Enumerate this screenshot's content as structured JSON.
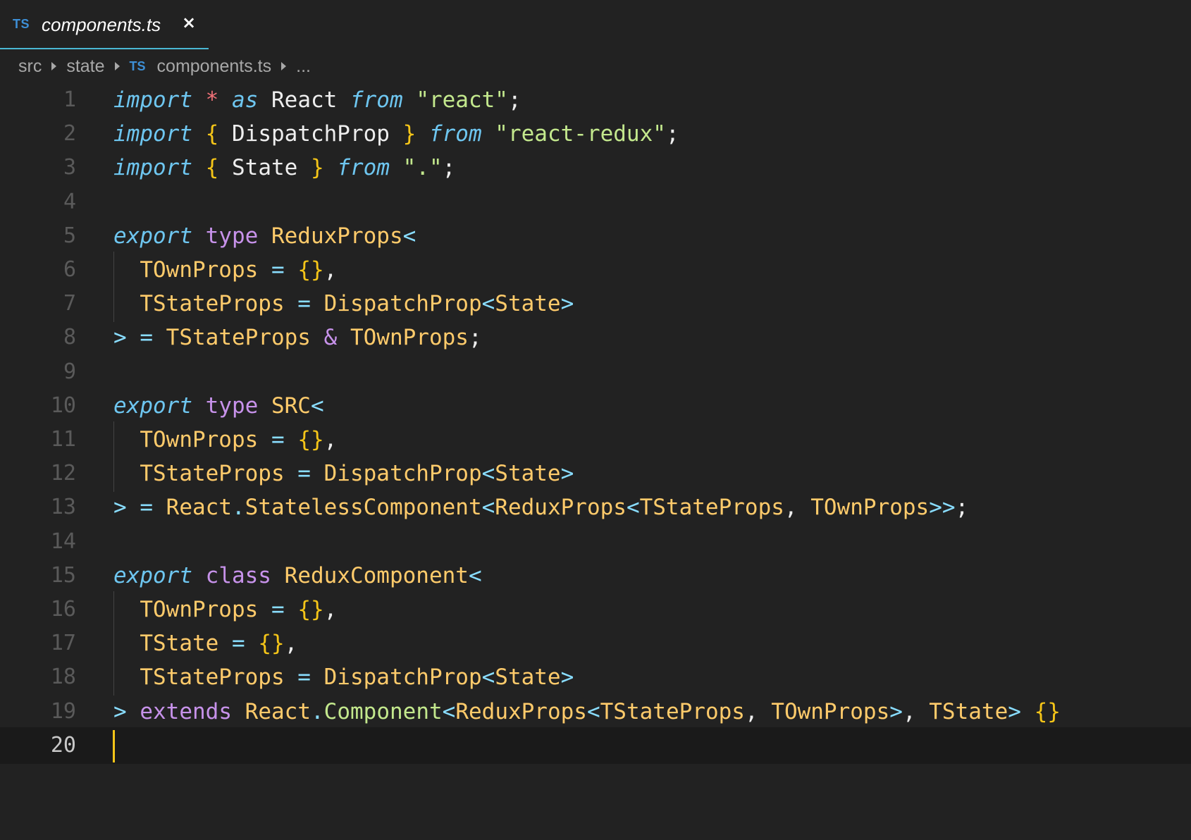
{
  "tab": {
    "icon_text": "TS",
    "label": "components.ts",
    "close_glyph": "×"
  },
  "breadcrumb": {
    "items": [
      "src",
      "state",
      "components.ts",
      "..."
    ],
    "file_icon_text": "TS"
  },
  "colors": {
    "keyword_italic": "#6ec6f0",
    "keyword_purple": "#c792ea",
    "type_name": "#ffcb6b",
    "string": "#c3e88d",
    "plain": "#eeeeee",
    "punct": "#89ddff",
    "brace": "#f5c518",
    "operator_star": "#f07178",
    "cursor": "#f5c518"
  },
  "editor": {
    "active_line": 20,
    "lines": [
      {
        "n": "1",
        "tokens": [
          {
            "t": "import",
            "c": "kwi"
          },
          {
            "t": " ",
            "c": "p"
          },
          {
            "t": "*",
            "c": "star"
          },
          {
            "t": " ",
            "c": "p"
          },
          {
            "t": "as",
            "c": "kwi"
          },
          {
            "t": " React ",
            "c": "p"
          },
          {
            "t": "from",
            "c": "kwi"
          },
          {
            "t": " ",
            "c": "p"
          },
          {
            "t": "\"react\"",
            "c": "str"
          },
          {
            "t": ";",
            "c": "p"
          }
        ]
      },
      {
        "n": "2",
        "tokens": [
          {
            "t": "import",
            "c": "kwi"
          },
          {
            "t": " ",
            "c": "p"
          },
          {
            "t": "{",
            "c": "br"
          },
          {
            "t": " DispatchProp ",
            "c": "p"
          },
          {
            "t": "}",
            "c": "br"
          },
          {
            "t": " ",
            "c": "p"
          },
          {
            "t": "from",
            "c": "kwi"
          },
          {
            "t": " ",
            "c": "p"
          },
          {
            "t": "\"react-redux\"",
            "c": "str"
          },
          {
            "t": ";",
            "c": "p"
          }
        ]
      },
      {
        "n": "3",
        "tokens": [
          {
            "t": "import",
            "c": "kwi"
          },
          {
            "t": " ",
            "c": "p"
          },
          {
            "t": "{",
            "c": "br"
          },
          {
            "t": " State ",
            "c": "p"
          },
          {
            "t": "}",
            "c": "br"
          },
          {
            "t": " ",
            "c": "p"
          },
          {
            "t": "from",
            "c": "kwi"
          },
          {
            "t": " ",
            "c": "p"
          },
          {
            "t": "\".\"",
            "c": "str"
          },
          {
            "t": ";",
            "c": "p"
          }
        ]
      },
      {
        "n": "4",
        "tokens": []
      },
      {
        "n": "5",
        "tokens": [
          {
            "t": "export",
            "c": "kwi"
          },
          {
            "t": " ",
            "c": "p"
          },
          {
            "t": "type",
            "c": "kwp"
          },
          {
            "t": " ",
            "c": "p"
          },
          {
            "t": "ReduxProps",
            "c": "ty"
          },
          {
            "t": "<",
            "c": "pu"
          }
        ]
      },
      {
        "n": "6",
        "guide": true,
        "tokens": [
          {
            "t": "  ",
            "c": "p"
          },
          {
            "t": "TOwnProps",
            "c": "ty"
          },
          {
            "t": " = ",
            "c": "pu"
          },
          {
            "t": "{}",
            "c": "br"
          },
          {
            "t": ",",
            "c": "p"
          }
        ]
      },
      {
        "n": "7",
        "guide": true,
        "tokens": [
          {
            "t": "  ",
            "c": "p"
          },
          {
            "t": "TStateProps",
            "c": "ty"
          },
          {
            "t": " = ",
            "c": "pu"
          },
          {
            "t": "DispatchProp",
            "c": "ty"
          },
          {
            "t": "<",
            "c": "pu"
          },
          {
            "t": "State",
            "c": "ty"
          },
          {
            "t": ">",
            "c": "pu"
          }
        ]
      },
      {
        "n": "8",
        "tokens": [
          {
            "t": ">",
            "c": "pu"
          },
          {
            "t": " = ",
            "c": "pu"
          },
          {
            "t": "TStateProps",
            "c": "ty"
          },
          {
            "t": " ",
            "c": "p"
          },
          {
            "t": "&",
            "c": "kwp"
          },
          {
            "t": " ",
            "c": "p"
          },
          {
            "t": "TOwnProps",
            "c": "ty"
          },
          {
            "t": ";",
            "c": "p"
          }
        ]
      },
      {
        "n": "9",
        "tokens": []
      },
      {
        "n": "10",
        "tokens": [
          {
            "t": "export",
            "c": "kwi"
          },
          {
            "t": " ",
            "c": "p"
          },
          {
            "t": "type",
            "c": "kwp"
          },
          {
            "t": " ",
            "c": "p"
          },
          {
            "t": "SRC",
            "c": "ty"
          },
          {
            "t": "<",
            "c": "pu"
          }
        ]
      },
      {
        "n": "11",
        "guide": true,
        "tokens": [
          {
            "t": "  ",
            "c": "p"
          },
          {
            "t": "TOwnProps",
            "c": "ty"
          },
          {
            "t": " = ",
            "c": "pu"
          },
          {
            "t": "{}",
            "c": "br"
          },
          {
            "t": ",",
            "c": "p"
          }
        ]
      },
      {
        "n": "12",
        "guide": true,
        "tokens": [
          {
            "t": "  ",
            "c": "p"
          },
          {
            "t": "TStateProps",
            "c": "ty"
          },
          {
            "t": " = ",
            "c": "pu"
          },
          {
            "t": "DispatchProp",
            "c": "ty"
          },
          {
            "t": "<",
            "c": "pu"
          },
          {
            "t": "State",
            "c": "ty"
          },
          {
            "t": ">",
            "c": "pu"
          }
        ]
      },
      {
        "n": "13",
        "tokens": [
          {
            "t": ">",
            "c": "pu"
          },
          {
            "t": " = ",
            "c": "pu"
          },
          {
            "t": "React",
            "c": "ty"
          },
          {
            "t": ".",
            "c": "pu"
          },
          {
            "t": "StatelessComponent",
            "c": "ty"
          },
          {
            "t": "<",
            "c": "pu"
          },
          {
            "t": "ReduxProps",
            "c": "ty"
          },
          {
            "t": "<",
            "c": "pu"
          },
          {
            "t": "TStateProps",
            "c": "ty"
          },
          {
            "t": ", ",
            "c": "p"
          },
          {
            "t": "TOwnProps",
            "c": "ty"
          },
          {
            "t": ">>",
            "c": "pu"
          },
          {
            "t": ";",
            "c": "p"
          }
        ]
      },
      {
        "n": "14",
        "tokens": []
      },
      {
        "n": "15",
        "tokens": [
          {
            "t": "export",
            "c": "kwi"
          },
          {
            "t": " ",
            "c": "p"
          },
          {
            "t": "class",
            "c": "kwp"
          },
          {
            "t": " ",
            "c": "p"
          },
          {
            "t": "ReduxComponent",
            "c": "ty"
          },
          {
            "t": "<",
            "c": "pu"
          }
        ]
      },
      {
        "n": "16",
        "guide": true,
        "tokens": [
          {
            "t": "  ",
            "c": "p"
          },
          {
            "t": "TOwnProps",
            "c": "ty"
          },
          {
            "t": " = ",
            "c": "pu"
          },
          {
            "t": "{}",
            "c": "br"
          },
          {
            "t": ",",
            "c": "p"
          }
        ]
      },
      {
        "n": "17",
        "guide": true,
        "tokens": [
          {
            "t": "  ",
            "c": "p"
          },
          {
            "t": "TState",
            "c": "ty"
          },
          {
            "t": " = ",
            "c": "pu"
          },
          {
            "t": "{}",
            "c": "br"
          },
          {
            "t": ",",
            "c": "p"
          }
        ]
      },
      {
        "n": "18",
        "guide": true,
        "tokens": [
          {
            "t": "  ",
            "c": "p"
          },
          {
            "t": "TStateProps",
            "c": "ty"
          },
          {
            "t": " = ",
            "c": "pu"
          },
          {
            "t": "DispatchProp",
            "c": "ty"
          },
          {
            "t": "<",
            "c": "pu"
          },
          {
            "t": "State",
            "c": "ty"
          },
          {
            "t": ">",
            "c": "pu"
          }
        ]
      },
      {
        "n": "19",
        "tokens": [
          {
            "t": ">",
            "c": "pu"
          },
          {
            "t": " ",
            "c": "p"
          },
          {
            "t": "extends",
            "c": "kwp"
          },
          {
            "t": " ",
            "c": "p"
          },
          {
            "t": "React",
            "c": "ty"
          },
          {
            "t": ".",
            "c": "pu"
          },
          {
            "t": "Component",
            "c": "fn"
          },
          {
            "t": "<",
            "c": "pu"
          },
          {
            "t": "ReduxProps",
            "c": "ty"
          },
          {
            "t": "<",
            "c": "pu"
          },
          {
            "t": "TStateProps",
            "c": "ty"
          },
          {
            "t": ", ",
            "c": "p"
          },
          {
            "t": "TOwnProps",
            "c": "ty"
          },
          {
            "t": ">",
            "c": "pu"
          },
          {
            "t": ", ",
            "c": "p"
          },
          {
            "t": "TState",
            "c": "ty"
          },
          {
            "t": ">",
            "c": "pu"
          },
          {
            "t": " ",
            "c": "p"
          },
          {
            "t": "{}",
            "c": "br"
          }
        ]
      },
      {
        "n": "20",
        "tokens": []
      }
    ]
  }
}
